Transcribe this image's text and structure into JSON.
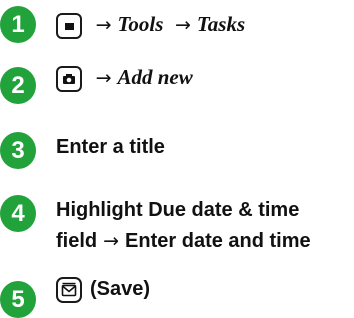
{
  "steps": [
    {
      "number": "1",
      "tools": "Tools",
      "tasks": "Tasks"
    },
    {
      "number": "2",
      "add_new": "Add new"
    },
    {
      "number": "3",
      "text": "Enter a title"
    },
    {
      "number": "4",
      "line1": "Highlight Due date & time",
      "line2_a": "field",
      "line2_b": "Enter date and time"
    },
    {
      "number": "5",
      "save": "(Save)"
    }
  ],
  "arrow": "→",
  "icons": {
    "menu_key": "menu-key-icon",
    "camera_key": "camera-key-icon",
    "mail_key": "mail-key-icon"
  },
  "accent_color": "#22a23a"
}
